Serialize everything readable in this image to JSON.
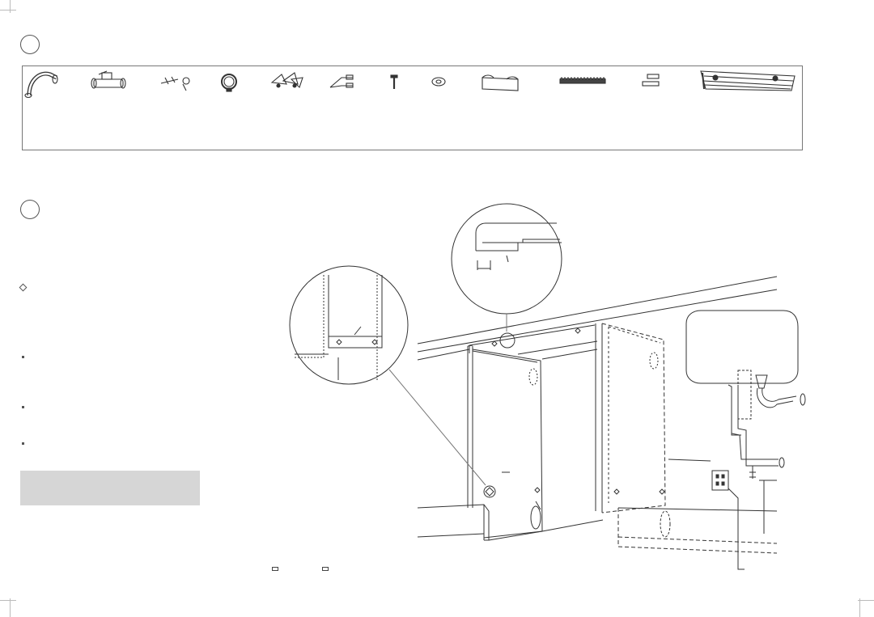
{
  "figure": {
    "title": "",
    "parts_list": {
      "icons": [
        "elbow-pipe-icon",
        "valve-icon",
        "clip-icon",
        "hose-clamp-icon",
        "hinge-parts-icon",
        "bracket-icon",
        "screw-icon",
        "washer-icon",
        "foam-strip-icon",
        "serrated-strip-icon",
        "spacer-blocks-icon",
        "panel-plate-icon"
      ]
    },
    "installation_diagram": {
      "icons": [
        "cabinet-icon",
        "water-heater-icon",
        "electrical-outlet-icon",
        "zoom-detail-icon"
      ]
    },
    "colors": {
      "line": "#333333",
      "note_box": "#d6d6d6",
      "frame": "#777777"
    }
  }
}
